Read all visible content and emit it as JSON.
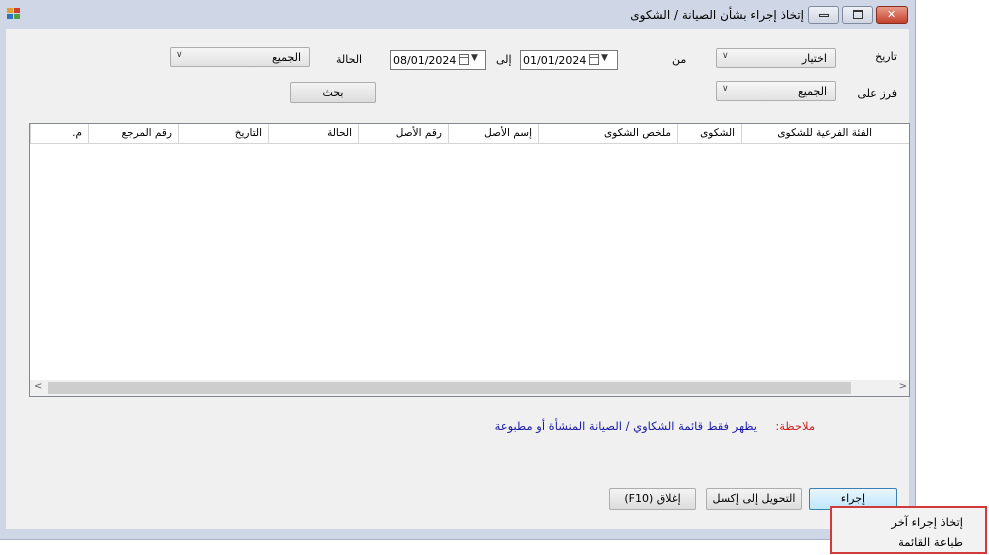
{
  "window": {
    "title": "إتخاذ إجراء بشأن الصيانة / الشكوى",
    "controls": {
      "minimize": "▭",
      "maximize": "▢",
      "close": "✕"
    }
  },
  "filters": {
    "date_label": "تاريخ",
    "date_type_value": "اختيار",
    "from_label": "من",
    "from_date": "01/01/2024",
    "to_label": "إلى",
    "to_date": "08/01/2024",
    "status_label": "الحالة",
    "status_value": "الجميع",
    "sort_label": "فرز على",
    "sort_value": "الجميع",
    "search_button": "بحث"
  },
  "table": {
    "columns": [
      "الفئة الفرعية للشكوى",
      "الشكوى",
      "ملخص الشكوى",
      "إسم الأصل",
      "رقم الأصل",
      "الحالة",
      "التاريخ",
      "رقم المرجع",
      "م."
    ],
    "rows": []
  },
  "note": {
    "label": "ملاحظة:",
    "text": "يظهر فقط قائمة الشكاوي / الصيانة المنشأة أو مطبوعة"
  },
  "buttons": {
    "action": "إجراء",
    "export_excel": "التحويل إلى إكسل",
    "close": "إغلاق (F10)"
  },
  "context_menu": {
    "items": [
      "إتخاذ إجراء آخر",
      "طباعة القائمة"
    ]
  }
}
